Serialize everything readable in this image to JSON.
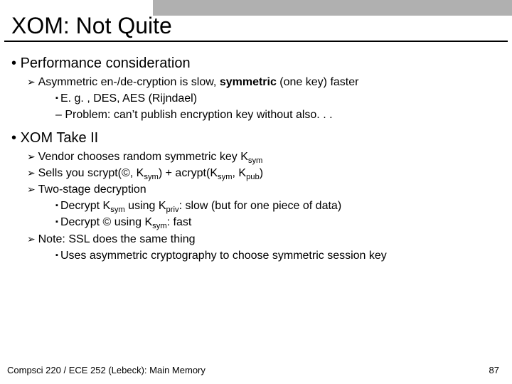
{
  "title": "XOM: Not Quite",
  "b1": {
    "head": "Performance consideration",
    "p1_a": "Asymmetric en-/de-cryption is slow, ",
    "p1_b": "symmetric",
    "p1_c": " (one key) faster",
    "p2": "E. g. , DES, AES (Rijndael)",
    "p3": "Problem: can’t publish encryption key without also. . ."
  },
  "b2": {
    "head": "XOM Take II",
    "p1_a": "Vendor chooses random symmetric key K",
    "p1_s": "sym",
    "p2_a": "Sells you scrypt(©, K",
    "p2_s1": "sym",
    "p2_b": ") + acrypt(K",
    "p2_s2": "sym",
    "p2_c": ", K",
    "p2_s3": "pub",
    "p2_d": ")",
    "p3": "Two-stage decryption",
    "p4_a": "Decrypt K",
    "p4_s1": "sym",
    "p4_b": " using K",
    "p4_s2": "priv",
    "p4_c": ": slow (but for one piece of data)",
    "p5_a": "Decrypt © using K",
    "p5_s1": "sym",
    "p5_b": ": fast",
    "p6": "Note: SSL does the same thing",
    "p7": "Uses asymmetric cryptography to choose symmetric session key"
  },
  "footer_left": "Compsci 220 / ECE 252 (Lebeck): Main Memory",
  "footer_right": "87"
}
